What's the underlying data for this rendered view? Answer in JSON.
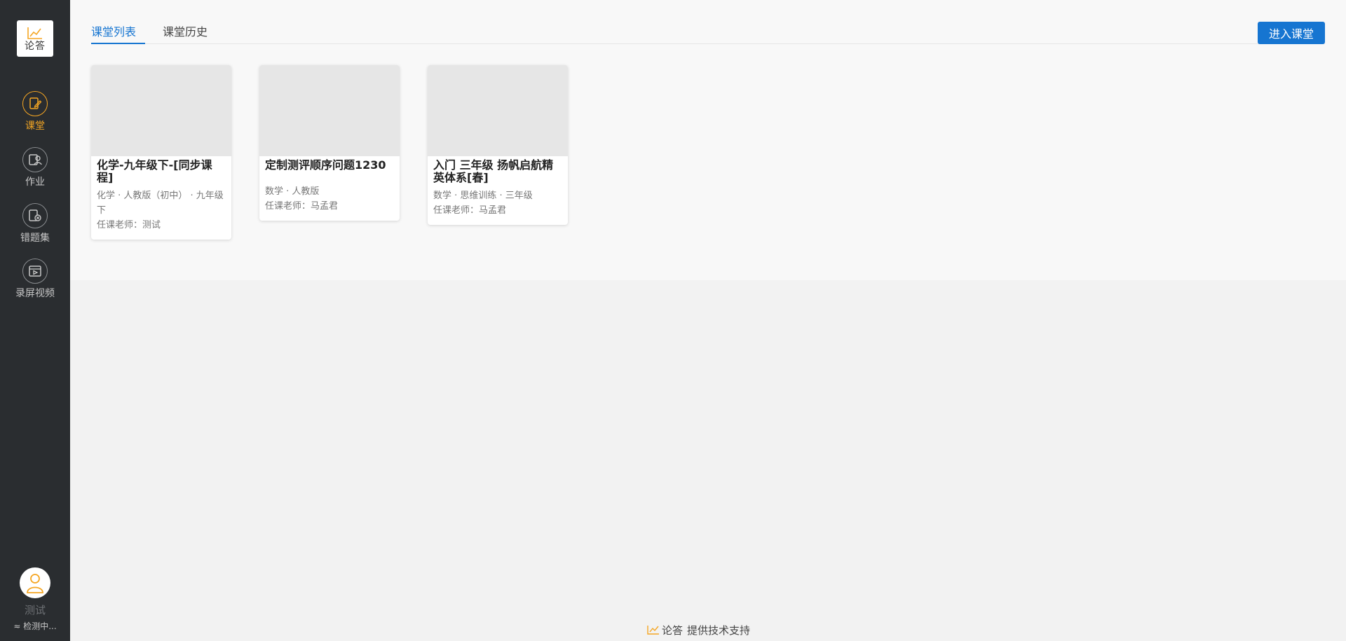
{
  "sidebar": {
    "logo_text": "论答",
    "nav": [
      {
        "label": "课堂",
        "icon": "classroom-icon",
        "active": true
      },
      {
        "label": "作业",
        "icon": "homework-icon",
        "active": false
      },
      {
        "label": "错题集",
        "icon": "mistakes-icon",
        "active": false
      },
      {
        "label": "录屏视频",
        "icon": "screen-record-icon",
        "active": false
      }
    ],
    "user": {
      "name": "测试",
      "status": "检测中..."
    }
  },
  "tabs": [
    {
      "label": "课堂列表",
      "active": true
    },
    {
      "label": "课堂历史",
      "active": false
    }
  ],
  "enter_button": "进入课堂",
  "courses": [
    {
      "title": "化学-九年级下-[同步课程]",
      "meta": "化学 · 人教版（初中） · 九年级下",
      "teacher": "任课老师：测试"
    },
    {
      "title": "定制测评顺序问题1230",
      "meta": "数学 · 人教版",
      "teacher": "任课老师：马孟君"
    },
    {
      "title": "入门 三年级 扬帆启航精英体系[春]",
      "meta": "数学 · 思维训练 · 三年级",
      "teacher": "任课老师：马孟君"
    }
  ],
  "footer": {
    "logo_text": "论答",
    "text": "提供技术支持"
  },
  "colors": {
    "accent": "#1675d1",
    "active_nav": "#f5a623",
    "sidebar_bg": "#2a2d30"
  }
}
